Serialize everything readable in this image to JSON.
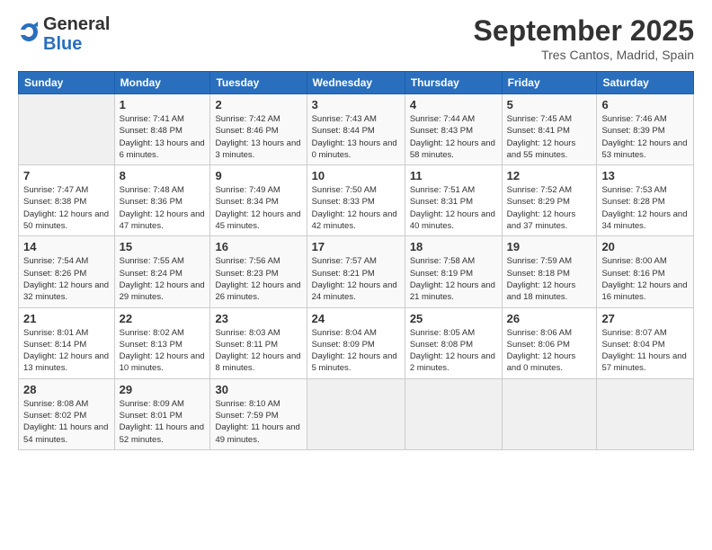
{
  "header": {
    "logo_general": "General",
    "logo_blue": "Blue",
    "month_title": "September 2025",
    "location": "Tres Cantos, Madrid, Spain"
  },
  "days_of_week": [
    "Sunday",
    "Monday",
    "Tuesday",
    "Wednesday",
    "Thursday",
    "Friday",
    "Saturday"
  ],
  "weeks": [
    [
      {
        "day": "",
        "info": ""
      },
      {
        "day": "1",
        "info": "Sunrise: 7:41 AM\nSunset: 8:48 PM\nDaylight: 13 hours\nand 6 minutes."
      },
      {
        "day": "2",
        "info": "Sunrise: 7:42 AM\nSunset: 8:46 PM\nDaylight: 13 hours\nand 3 minutes."
      },
      {
        "day": "3",
        "info": "Sunrise: 7:43 AM\nSunset: 8:44 PM\nDaylight: 13 hours\nand 0 minutes."
      },
      {
        "day": "4",
        "info": "Sunrise: 7:44 AM\nSunset: 8:43 PM\nDaylight: 12 hours\nand 58 minutes."
      },
      {
        "day": "5",
        "info": "Sunrise: 7:45 AM\nSunset: 8:41 PM\nDaylight: 12 hours\nand 55 minutes."
      },
      {
        "day": "6",
        "info": "Sunrise: 7:46 AM\nSunset: 8:39 PM\nDaylight: 12 hours\nand 53 minutes."
      }
    ],
    [
      {
        "day": "7",
        "info": "Sunrise: 7:47 AM\nSunset: 8:38 PM\nDaylight: 12 hours\nand 50 minutes."
      },
      {
        "day": "8",
        "info": "Sunrise: 7:48 AM\nSunset: 8:36 PM\nDaylight: 12 hours\nand 47 minutes."
      },
      {
        "day": "9",
        "info": "Sunrise: 7:49 AM\nSunset: 8:34 PM\nDaylight: 12 hours\nand 45 minutes."
      },
      {
        "day": "10",
        "info": "Sunrise: 7:50 AM\nSunset: 8:33 PM\nDaylight: 12 hours\nand 42 minutes."
      },
      {
        "day": "11",
        "info": "Sunrise: 7:51 AM\nSunset: 8:31 PM\nDaylight: 12 hours\nand 40 minutes."
      },
      {
        "day": "12",
        "info": "Sunrise: 7:52 AM\nSunset: 8:29 PM\nDaylight: 12 hours\nand 37 minutes."
      },
      {
        "day": "13",
        "info": "Sunrise: 7:53 AM\nSunset: 8:28 PM\nDaylight: 12 hours\nand 34 minutes."
      }
    ],
    [
      {
        "day": "14",
        "info": "Sunrise: 7:54 AM\nSunset: 8:26 PM\nDaylight: 12 hours\nand 32 minutes."
      },
      {
        "day": "15",
        "info": "Sunrise: 7:55 AM\nSunset: 8:24 PM\nDaylight: 12 hours\nand 29 minutes."
      },
      {
        "day": "16",
        "info": "Sunrise: 7:56 AM\nSunset: 8:23 PM\nDaylight: 12 hours\nand 26 minutes."
      },
      {
        "day": "17",
        "info": "Sunrise: 7:57 AM\nSunset: 8:21 PM\nDaylight: 12 hours\nand 24 minutes."
      },
      {
        "day": "18",
        "info": "Sunrise: 7:58 AM\nSunset: 8:19 PM\nDaylight: 12 hours\nand 21 minutes."
      },
      {
        "day": "19",
        "info": "Sunrise: 7:59 AM\nSunset: 8:18 PM\nDaylight: 12 hours\nand 18 minutes."
      },
      {
        "day": "20",
        "info": "Sunrise: 8:00 AM\nSunset: 8:16 PM\nDaylight: 12 hours\nand 16 minutes."
      }
    ],
    [
      {
        "day": "21",
        "info": "Sunrise: 8:01 AM\nSunset: 8:14 PM\nDaylight: 12 hours\nand 13 minutes."
      },
      {
        "day": "22",
        "info": "Sunrise: 8:02 AM\nSunset: 8:13 PM\nDaylight: 12 hours\nand 10 minutes."
      },
      {
        "day": "23",
        "info": "Sunrise: 8:03 AM\nSunset: 8:11 PM\nDaylight: 12 hours\nand 8 minutes."
      },
      {
        "day": "24",
        "info": "Sunrise: 8:04 AM\nSunset: 8:09 PM\nDaylight: 12 hours\nand 5 minutes."
      },
      {
        "day": "25",
        "info": "Sunrise: 8:05 AM\nSunset: 8:08 PM\nDaylight: 12 hours\nand 2 minutes."
      },
      {
        "day": "26",
        "info": "Sunrise: 8:06 AM\nSunset: 8:06 PM\nDaylight: 12 hours\nand 0 minutes."
      },
      {
        "day": "27",
        "info": "Sunrise: 8:07 AM\nSunset: 8:04 PM\nDaylight: 11 hours\nand 57 minutes."
      }
    ],
    [
      {
        "day": "28",
        "info": "Sunrise: 8:08 AM\nSunset: 8:02 PM\nDaylight: 11 hours\nand 54 minutes."
      },
      {
        "day": "29",
        "info": "Sunrise: 8:09 AM\nSunset: 8:01 PM\nDaylight: 11 hours\nand 52 minutes."
      },
      {
        "day": "30",
        "info": "Sunrise: 8:10 AM\nSunset: 7:59 PM\nDaylight: 11 hours\nand 49 minutes."
      },
      {
        "day": "",
        "info": ""
      },
      {
        "day": "",
        "info": ""
      },
      {
        "day": "",
        "info": ""
      },
      {
        "day": "",
        "info": ""
      }
    ]
  ]
}
